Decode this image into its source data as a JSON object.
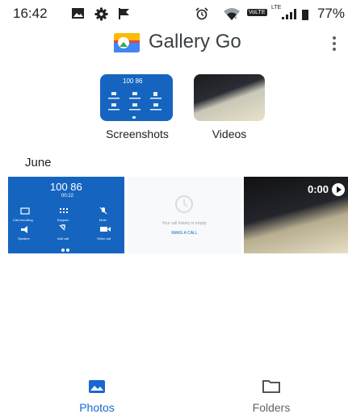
{
  "status_bar": {
    "time": "16:42",
    "left_icons": [
      "image-icon",
      "gear-icon",
      "flag-icon"
    ],
    "right_icons": [
      "alarm-icon",
      "wifi-icon",
      "volte-icon",
      "lte-signal-icon",
      "battery-icon"
    ],
    "volte": "VoLTE",
    "lte": "LTE",
    "battery_percent": "77%"
  },
  "app_bar": {
    "title": "Gallery Go",
    "logo": "gallery-go-logo",
    "menu_icon": "more-vert-icon"
  },
  "albums": [
    {
      "label": "Screenshots",
      "thumb_number": "100 86"
    },
    {
      "label": "Videos"
    }
  ],
  "section": {
    "date": "June"
  },
  "grid": {
    "call_screen": {
      "number": "100 86",
      "timer": "00:22",
      "buttons": [
        "Call recording",
        "Keypad",
        "Mute",
        "Speaker",
        "Add call",
        "Video call"
      ]
    },
    "call_history": {
      "message": "Your call history is empty.",
      "action": "MAKE A CALL"
    },
    "video": {
      "duration": "0:00"
    }
  },
  "colors": {
    "accent": "#1967d2",
    "call_screen_blue": "#1565c0",
    "text_primary": "#202124",
    "text_secondary": "#5f6368"
  },
  "bottom_nav": {
    "items": [
      {
        "label": "Photos",
        "icon": "photo-icon",
        "selected": true
      },
      {
        "label": "Folders",
        "icon": "folder-icon",
        "selected": false
      }
    ]
  }
}
